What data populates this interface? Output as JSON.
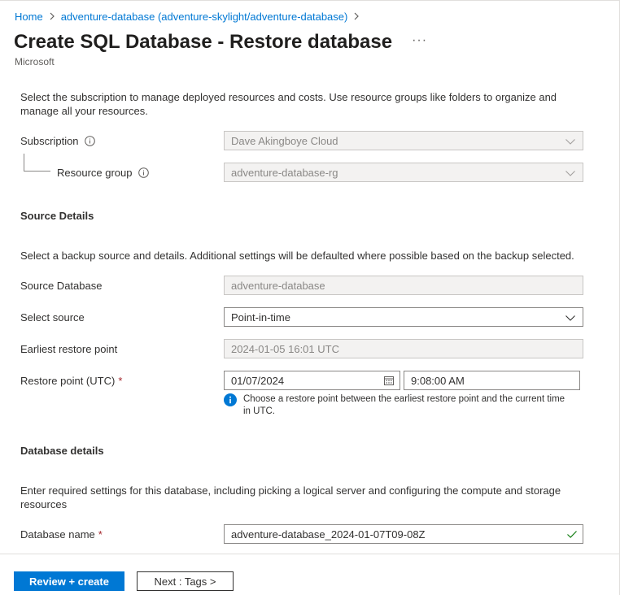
{
  "breadcrumb": {
    "home": "Home",
    "resource": "adventure-database (adventure-skylight/adventure-database)"
  },
  "header": {
    "title": "Create SQL Database - Restore database",
    "more": "···",
    "publisher": "Microsoft"
  },
  "project": {
    "description": "Select the subscription to manage deployed resources and costs. Use resource groups like folders to organize and manage all your resources.",
    "subscription_label": "Subscription",
    "subscription_value": "Dave Akingboye Cloud",
    "resource_group_label": "Resource group",
    "resource_group_value": "adventure-database-rg"
  },
  "source": {
    "heading": "Source Details",
    "description": "Select a backup source and details. Additional settings will be defaulted where possible based on the backup selected.",
    "source_database_label": "Source Database",
    "source_database_value": "adventure-database",
    "select_source_label": "Select source",
    "select_source_value": "Point-in-time",
    "earliest_label": "Earliest restore point",
    "earliest_value": "2024-01-05 16:01 UTC",
    "restore_point_label": "Restore point (UTC)",
    "required_mark": "*",
    "restore_date": "01/07/2024",
    "restore_time": "9:08:00 AM",
    "info_text": "Choose a restore point between the earliest restore point and the current time in UTC."
  },
  "database": {
    "heading": "Database details",
    "description": "Enter required settings for this database, including picking a logical server and configuring the compute and storage resources",
    "name_label": "Database name",
    "required_mark": "*",
    "name_value": "adventure-database_2024-01-07T09-08Z"
  },
  "footer": {
    "review_create": "Review + create",
    "next_tags": "Next : Tags >"
  },
  "colors": {
    "accent": "#0078d4",
    "required": "#a4262c",
    "valid": "#107c10"
  }
}
